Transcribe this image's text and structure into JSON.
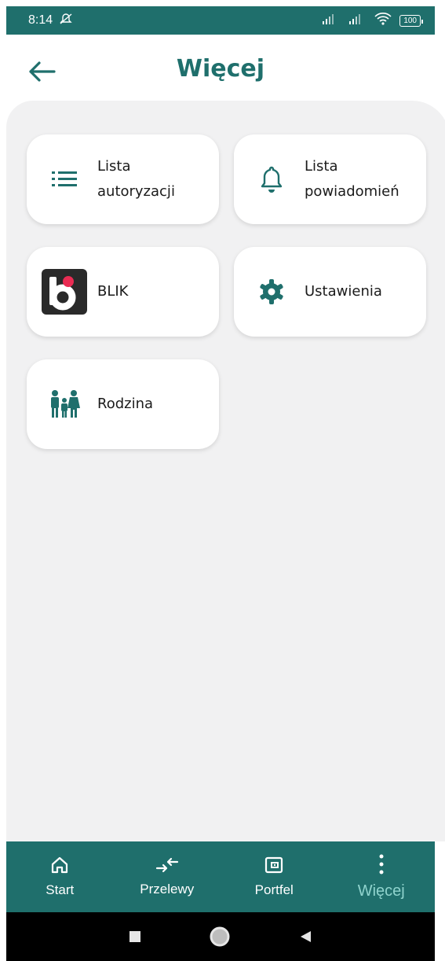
{
  "status": {
    "time": "8:14",
    "battery": "100"
  },
  "header": {
    "title": "Więcej"
  },
  "tiles": [
    {
      "label": "Lista\nautoryzacji",
      "icon": "list-icon"
    },
    {
      "label": "Lista\npowiadomień",
      "icon": "bell-icon"
    },
    {
      "label": "BLIK",
      "icon": "blik-logo"
    },
    {
      "label": "Ustawienia",
      "icon": "gear-icon"
    },
    {
      "label": "Rodzina",
      "icon": "family-icon"
    }
  ],
  "bottom_nav": [
    {
      "label": "Start",
      "icon": "home-icon"
    },
    {
      "label": "Przelewy",
      "icon": "transfer-icon"
    },
    {
      "label": "Portfel",
      "icon": "wallet-icon"
    },
    {
      "label": "Więcej",
      "icon": "more-vertical-icon",
      "active": true
    }
  ],
  "colors": {
    "primary": "#1f6f6c",
    "active_nav": "#8fd3cd",
    "blik_dot": "#ea2c53"
  }
}
